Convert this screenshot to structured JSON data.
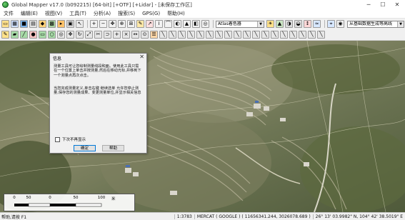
{
  "window": {
    "title": "Global Mapper v17.0 (b092215) [64-bit] [+OTF] [+Lidar] - [未保存工作区]",
    "minimize": "─",
    "maximize": "☐",
    "close": "✕"
  },
  "menu": [
    "文件",
    "编辑(E)",
    "视图(V)",
    "工具(T)",
    "分析(A)",
    "搜索(S)",
    "GPS(G)",
    "帮助(H)"
  ],
  "toolbar": {
    "shader_select": "Atlas着色器",
    "search_input": "从基础数据生成等高线"
  },
  "dialog": {
    "title": "信息",
    "close": "✕",
    "paragraph1": "测量工具可让您绘制测量线段和面。使用此工具只需在一个位置上单击并按测量,然后在移动光标,并移到下一个测量点再次点击。",
    "paragraph2": "当您完成测量定义,单击右键 继续选单 允许您停止测量,保存您的测量成果、变更测量单位,并显示相关信息",
    "checkbox_label": "下次不再显示",
    "ok_button": "确定",
    "help_button": "帮助"
  },
  "scalebar": {
    "ticks": [
      "0",
      "50",
      "0",
      "50",
      "100"
    ],
    "unit": "米"
  },
  "status": {
    "left": "帮助,请按 F1",
    "scale": "1:3783",
    "projection": "MERCAT ( GOOGLE ) ( 11656341.244, 3026078.689 )",
    "coords": "26° 13' 03.9982\" N, 104° 42' 38.5019\" E"
  },
  "colors": {
    "annotation_arrow": "#e8262b",
    "ok_focus": "#0078d7"
  }
}
